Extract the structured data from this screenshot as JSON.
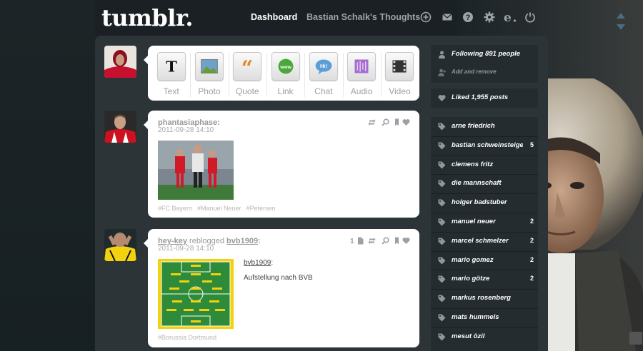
{
  "header": {
    "logo": "tumblr.",
    "nav_dashboard": "Dashboard",
    "nav_blog": "Bastian Schalk's Thoughts",
    "icons": [
      "plus-circle-icon",
      "mail-icon",
      "help-icon",
      "gear-icon",
      "e-icon",
      "power-icon"
    ]
  },
  "post_types": [
    {
      "label": "Text",
      "icon": "text-icon"
    },
    {
      "label": "Photo",
      "icon": "photo-icon"
    },
    {
      "label": "Quote",
      "icon": "quote-icon"
    },
    {
      "label": "Link",
      "icon": "link-icon"
    },
    {
      "label": "Chat",
      "icon": "chat-icon"
    },
    {
      "label": "Audio",
      "icon": "audio-icon"
    },
    {
      "label": "Video",
      "icon": "video-icon"
    }
  ],
  "posts": [
    {
      "user": "phantasiaphase:",
      "date": "2011-09-28 14:10",
      "tags": [
        "#FC Bayern",
        "#Manuel Neuer",
        "#Petersen"
      ]
    },
    {
      "user": "hey-key",
      "reblogged_text": "reblogged",
      "source": "bvb1909",
      "source_suffix": ":",
      "date": "2011-09-28 14:10",
      "note_count": "1",
      "quote_user": "bvb1909",
      "quote_suffix": ":",
      "body": "Aufstellung nach BVB",
      "tags": [
        "#Borussia Dortmund"
      ]
    }
  ],
  "sidebar": {
    "following": "Following 891 people",
    "add_remove": "Add and remove",
    "liked": "Liked 1,955 posts",
    "tags": [
      {
        "name": "arne friedrich",
        "count": ""
      },
      {
        "name": "bastian schweinsteiger",
        "count": "5"
      },
      {
        "name": "clemens fritz",
        "count": ""
      },
      {
        "name": "die mannschaft",
        "count": ""
      },
      {
        "name": "holger badstuber",
        "count": ""
      },
      {
        "name": "manuel neuer",
        "count": "2"
      },
      {
        "name": "marcel schmelzer",
        "count": "2"
      },
      {
        "name": "mario gomez",
        "count": "2"
      },
      {
        "name": "mario götze",
        "count": "2"
      },
      {
        "name": "markus rosenberg",
        "count": ""
      },
      {
        "name": "mats hummels",
        "count": ""
      },
      {
        "name": "mesut özil",
        "count": ""
      }
    ]
  },
  "colors": {
    "background": "#1a2023",
    "panel": "#2c3437",
    "sidebar": "#252c2f",
    "accent_arrows": "#4a6b82"
  }
}
